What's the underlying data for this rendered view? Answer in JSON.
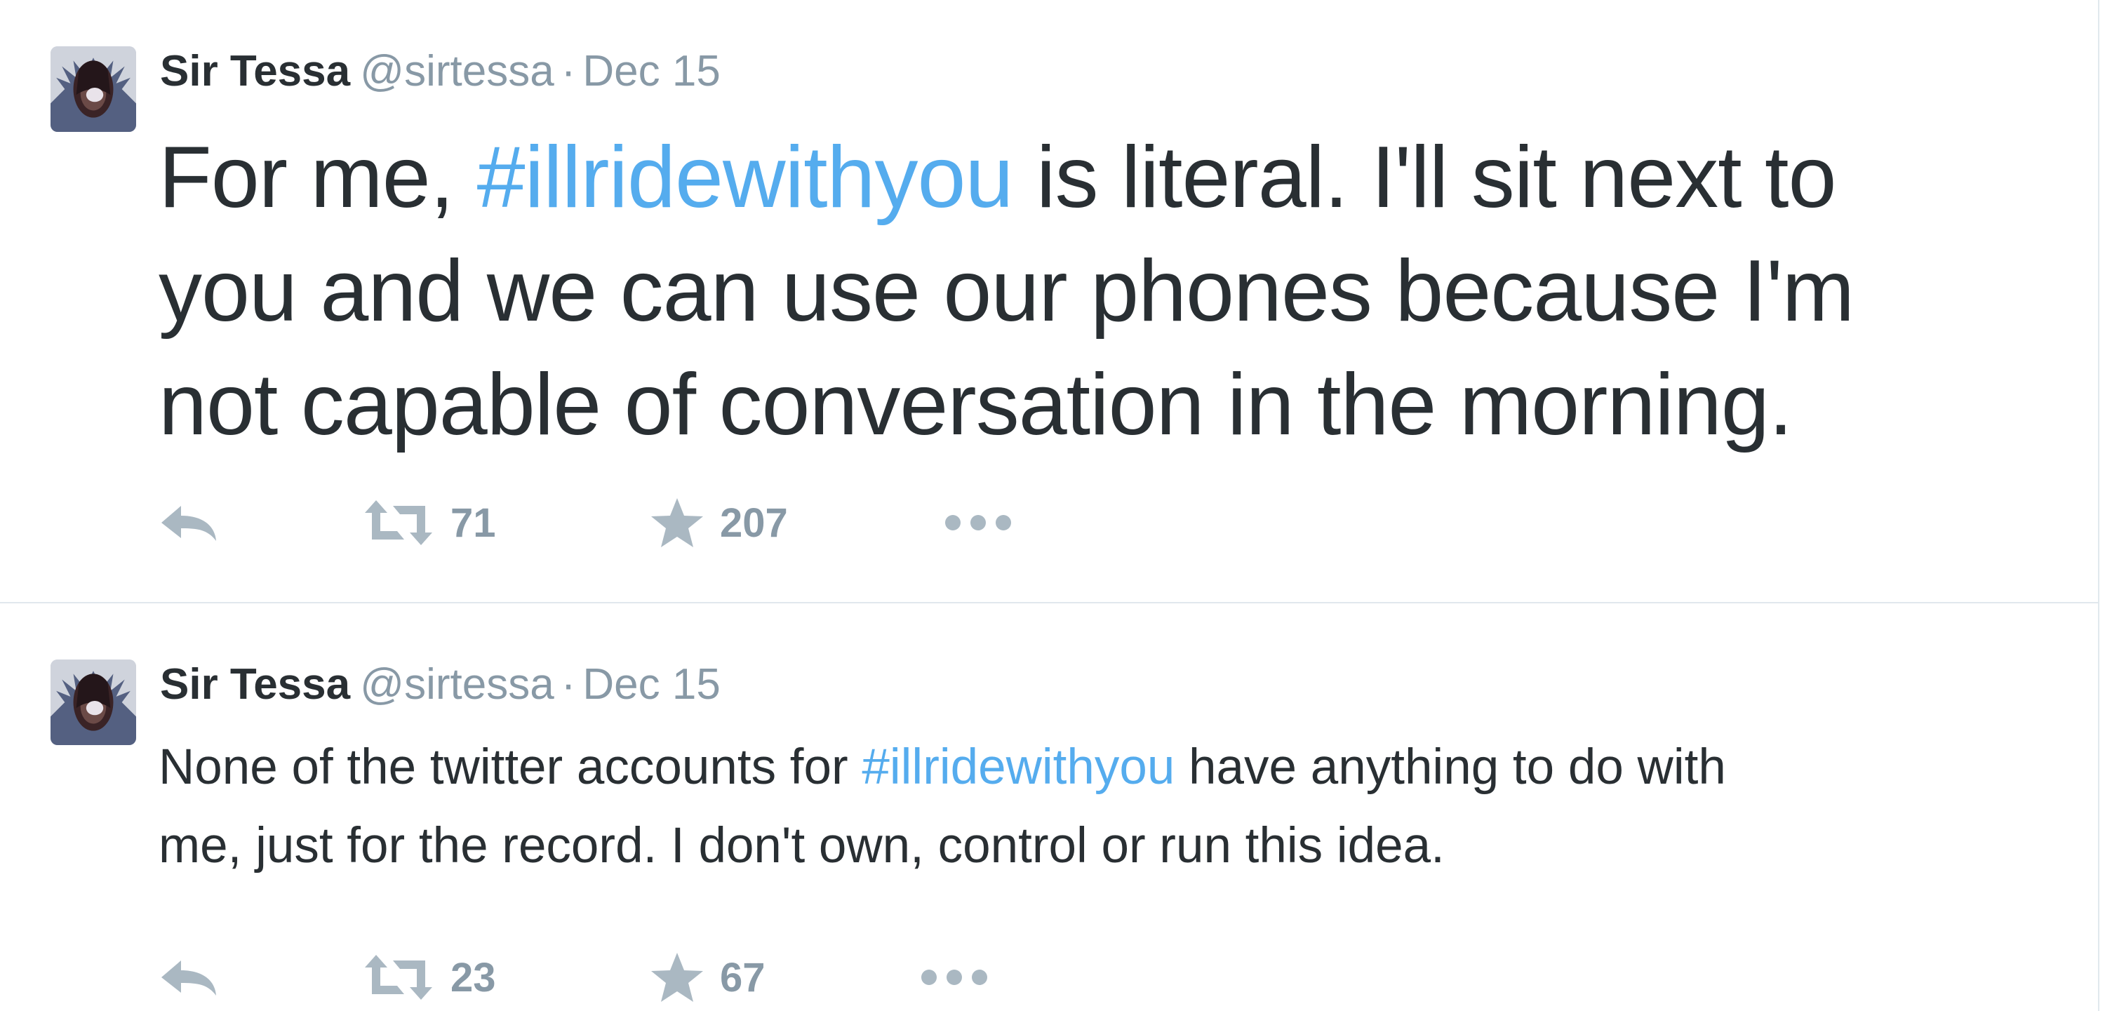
{
  "tweets": [
    {
      "fullname": "Sir Tessa",
      "username": "@sirtessa",
      "separator": "·",
      "time": "Dec 15",
      "text_lines": [
        [
          "For me, ",
          "#illridewithyou",
          " is literal. I'll sit next to"
        ],
        [
          "you and we can use our phones because I'm"
        ],
        [
          "not capable of conversation in the morning."
        ]
      ],
      "retweets": "71",
      "favorites": "207"
    },
    {
      "fullname": "Sir Tessa",
      "username": "@sirtessa",
      "separator": "·",
      "time": "Dec 15",
      "text_lines": [
        [
          "None of the twitter accounts for ",
          "#illridewithyou",
          " have anything to do with"
        ],
        [
          "me, just for the record. I don't own, control or run this idea."
        ]
      ],
      "retweets": "23",
      "favorites": "67"
    }
  ],
  "icons": {
    "reply": "reply-icon",
    "retweet": "retweet-icon",
    "favorite": "star-icon",
    "more": "more-icon"
  },
  "colors": {
    "hashtag": "#55acee",
    "text": "#292f33",
    "secondary": "#8899a6",
    "icon": "#aab8c2",
    "divider": "#e1e8ed"
  }
}
